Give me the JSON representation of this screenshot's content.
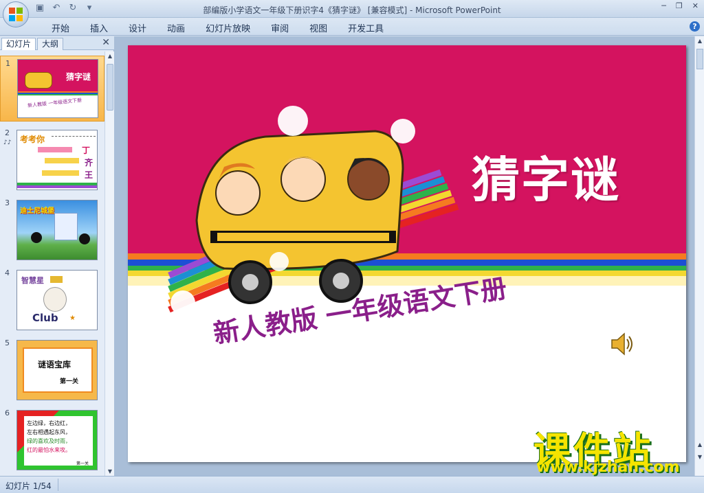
{
  "window": {
    "title": "部编版小学语文一年级下册识字4《猜字谜》 [兼容模式] - Microsoft PowerPoint"
  },
  "ribbon": {
    "tabs": [
      "开始",
      "插入",
      "设计",
      "动画",
      "幻灯片放映",
      "审阅",
      "视图",
      "开发工具"
    ]
  },
  "left_pane": {
    "tabs": [
      "幻灯片",
      "大纲"
    ],
    "thumbnails": [
      {
        "num": "1",
        "title": "猜字谜",
        "subtitle": "新人教版  一年级语文下册",
        "selected": true
      },
      {
        "num": "2",
        "note": "♪♪",
        "heading": "考考你",
        "chars": [
          "丁",
          "齐",
          "王"
        ]
      },
      {
        "num": "3",
        "heading": "迪士尼城堡"
      },
      {
        "num": "4",
        "heading": "智慧星",
        "logo_text": "Club"
      },
      {
        "num": "5",
        "title": "谜语宝库",
        "subtitle": "第一关"
      },
      {
        "num": "6",
        "lines": [
          "左边绿，右边红，",
          "左右相遇起东风，",
          "绿的喜欢及时雨，",
          "红的最怕水来攻。"
        ],
        "footer": "第一关"
      }
    ]
  },
  "slide": {
    "title": "猜字谜",
    "subtitle": "新人教版  一年级语文下册",
    "colors": {
      "top_bg": "#d4135f",
      "subtitle": "#8a1f8a"
    }
  },
  "status": {
    "slide_indicator": "幻灯片 1/54"
  },
  "watermark": {
    "brand": "课件站",
    "url": "www.kjzhan.com"
  }
}
